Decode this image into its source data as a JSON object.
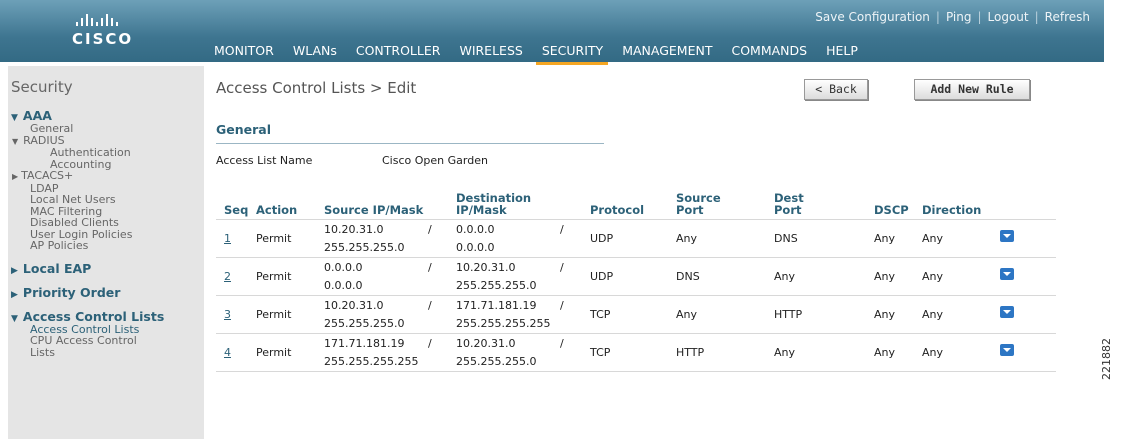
{
  "header": {
    "logo_text": "CISCO",
    "utility_links": [
      "Save Configuration",
      "Ping",
      "Logout",
      "Refresh"
    ],
    "nav": [
      "MONITOR",
      "WLANs",
      "CONTROLLER",
      "WIRELESS",
      "SECURITY",
      "MANAGEMENT",
      "COMMANDS",
      "HELP"
    ],
    "active_nav": "SECURITY",
    "colors": {
      "bar": "#3e7590",
      "active_underline": "#f5a623",
      "accent_text": "#2c6178"
    }
  },
  "sidebar": {
    "title": "Security",
    "aaa": {
      "label": "AAA",
      "general": "General",
      "radius": "RADIUS",
      "authentication": "Authentication",
      "accounting": "Accounting",
      "tacacs": "TACACS+",
      "ldap": "LDAP",
      "local_net_users": "Local Net Users",
      "mac_filtering": "MAC Filtering",
      "disabled_clients": "Disabled Clients",
      "user_login_policies": "User Login Policies",
      "ap_policies": "AP Policies"
    },
    "local_eap": "Local EAP",
    "priority_order": "Priority Order",
    "acl": {
      "label": "Access Control Lists",
      "acl_link": "Access Control Lists",
      "cpu_acl_1": "CPU Access Control",
      "cpu_acl_2": "Lists"
    }
  },
  "main": {
    "title": "Access Control Lists > Edit",
    "back_button": "< Back",
    "add_button": "Add New Rule",
    "general_title": "General",
    "acl_name_label": "Access List Name",
    "acl_name_value": "Cisco Open Garden"
  },
  "table": {
    "headers": {
      "seq": "Seq",
      "action": "Action",
      "src_ip": "Source IP/Mask",
      "dst_1": "Destination",
      "dst_2": "IP/Mask",
      "protocol": "Protocol",
      "src_port_1": "Source",
      "src_port_2": "Port",
      "dst_port_1": "Dest",
      "dst_port_2": "Port",
      "dscp": "DSCP",
      "direction": "Direction"
    },
    "rows": [
      {
        "seq": "1",
        "action": "Permit",
        "src_ip": "10.20.31.0",
        "src_mask": "255.255.255.0",
        "dst_ip": "0.0.0.0",
        "dst_mask": "0.0.0.0",
        "protocol": "UDP",
        "src_port": "Any",
        "dst_port": "DNS",
        "dscp": "Any",
        "direction": "Any"
      },
      {
        "seq": "2",
        "action": "Permit",
        "src_ip": "0.0.0.0",
        "src_mask": "0.0.0.0",
        "dst_ip": "10.20.31.0",
        "dst_mask": "255.255.255.0",
        "protocol": "UDP",
        "src_port": "DNS",
        "dst_port": "Any",
        "dscp": "Any",
        "direction": "Any"
      },
      {
        "seq": "3",
        "action": "Permit",
        "src_ip": "10.20.31.0",
        "src_mask": "255.255.255.0",
        "dst_ip": "171.71.181.19",
        "dst_mask": "255.255.255.255",
        "protocol": "TCP",
        "src_port": "Any",
        "dst_port": "HTTP",
        "dscp": "Any",
        "direction": "Any"
      },
      {
        "seq": "4",
        "action": "Permit",
        "src_ip": "171.71.181.19",
        "src_mask": "255.255.255.255",
        "dst_ip": "10.20.31.0",
        "dst_mask": "255.255.255.0",
        "protocol": "TCP",
        "src_port": "HTTP",
        "dst_port": "Any",
        "dscp": "Any",
        "direction": "Any"
      }
    ]
  },
  "figure_id": "221882"
}
